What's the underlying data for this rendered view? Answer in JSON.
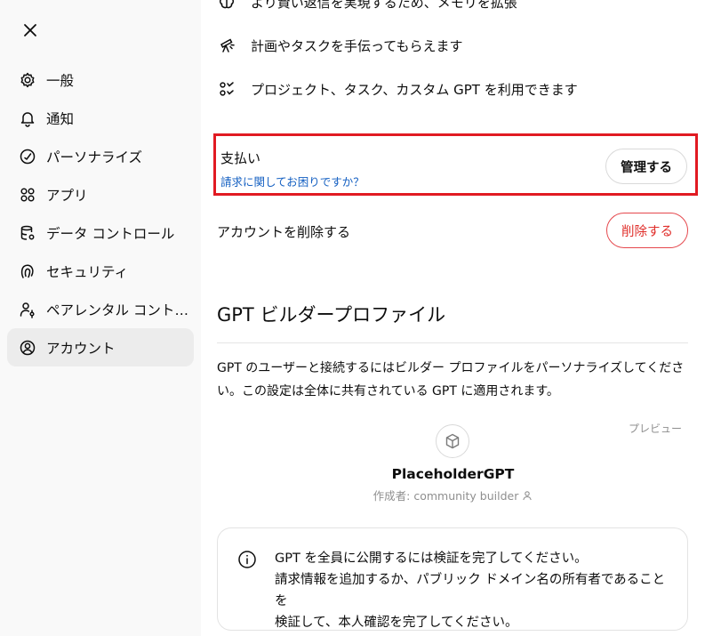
{
  "sidebar": {
    "items": [
      {
        "label": "一般",
        "icon": "gear-icon"
      },
      {
        "label": "通知",
        "icon": "bell-icon"
      },
      {
        "label": "パーソナライズ",
        "icon": "personalize-icon"
      },
      {
        "label": "アプリ",
        "icon": "apps-grid-icon"
      },
      {
        "label": "データ コントロール",
        "icon": "database-icon"
      },
      {
        "label": "セキュリティ",
        "icon": "security-icon"
      },
      {
        "label": "ペアレンタル コントロー...",
        "icon": "parental-icon"
      },
      {
        "label": "アカウント",
        "icon": "account-icon"
      }
    ],
    "active_index": 7
  },
  "features": [
    {
      "text": "より賢い返信を実現するため、メモリを拡張",
      "icon": "brain-icon"
    },
    {
      "text": "計画やタスクを手伝ってもらえます",
      "icon": "telescope-icon"
    },
    {
      "text": "プロジェクト、タスク、カスタム GPT を利用できます",
      "icon": "tasks-icon"
    }
  ],
  "payment": {
    "title": "支払い",
    "help_link": "請求に関してお困りですか？",
    "manage_button": "管理する"
  },
  "delete_account": {
    "label": "アカウントを削除する",
    "button": "削除する"
  },
  "builder_profile": {
    "title": "GPT ビルダープロファイル",
    "description": "GPT のユーザーと接続するにはビルダー プロファイルをパーソナライズしてください。この設定は全体に共有されている GPT に適用されます。",
    "preview_label": "プレビュー",
    "gpt_name": "PlaceholderGPT",
    "author": "作成者: community builder"
  },
  "notice": {
    "text": "GPT を全員に公開するには検証を完了してください。請求情報を追加するか、パブリック ドメイン名の所有者であることを検証して、本人確認を完了してください。",
    "line1": "GPT を全員に公開するには検証を完了してください。",
    "line2": "請求情報を追加するか、パブリック ドメイン名の所有者であることを",
    "line3": "検証して、本人確認を完了してください。"
  },
  "colors": {
    "highlight_border": "#e11a22",
    "link": "#1560c2",
    "danger": "#e02e2a"
  }
}
